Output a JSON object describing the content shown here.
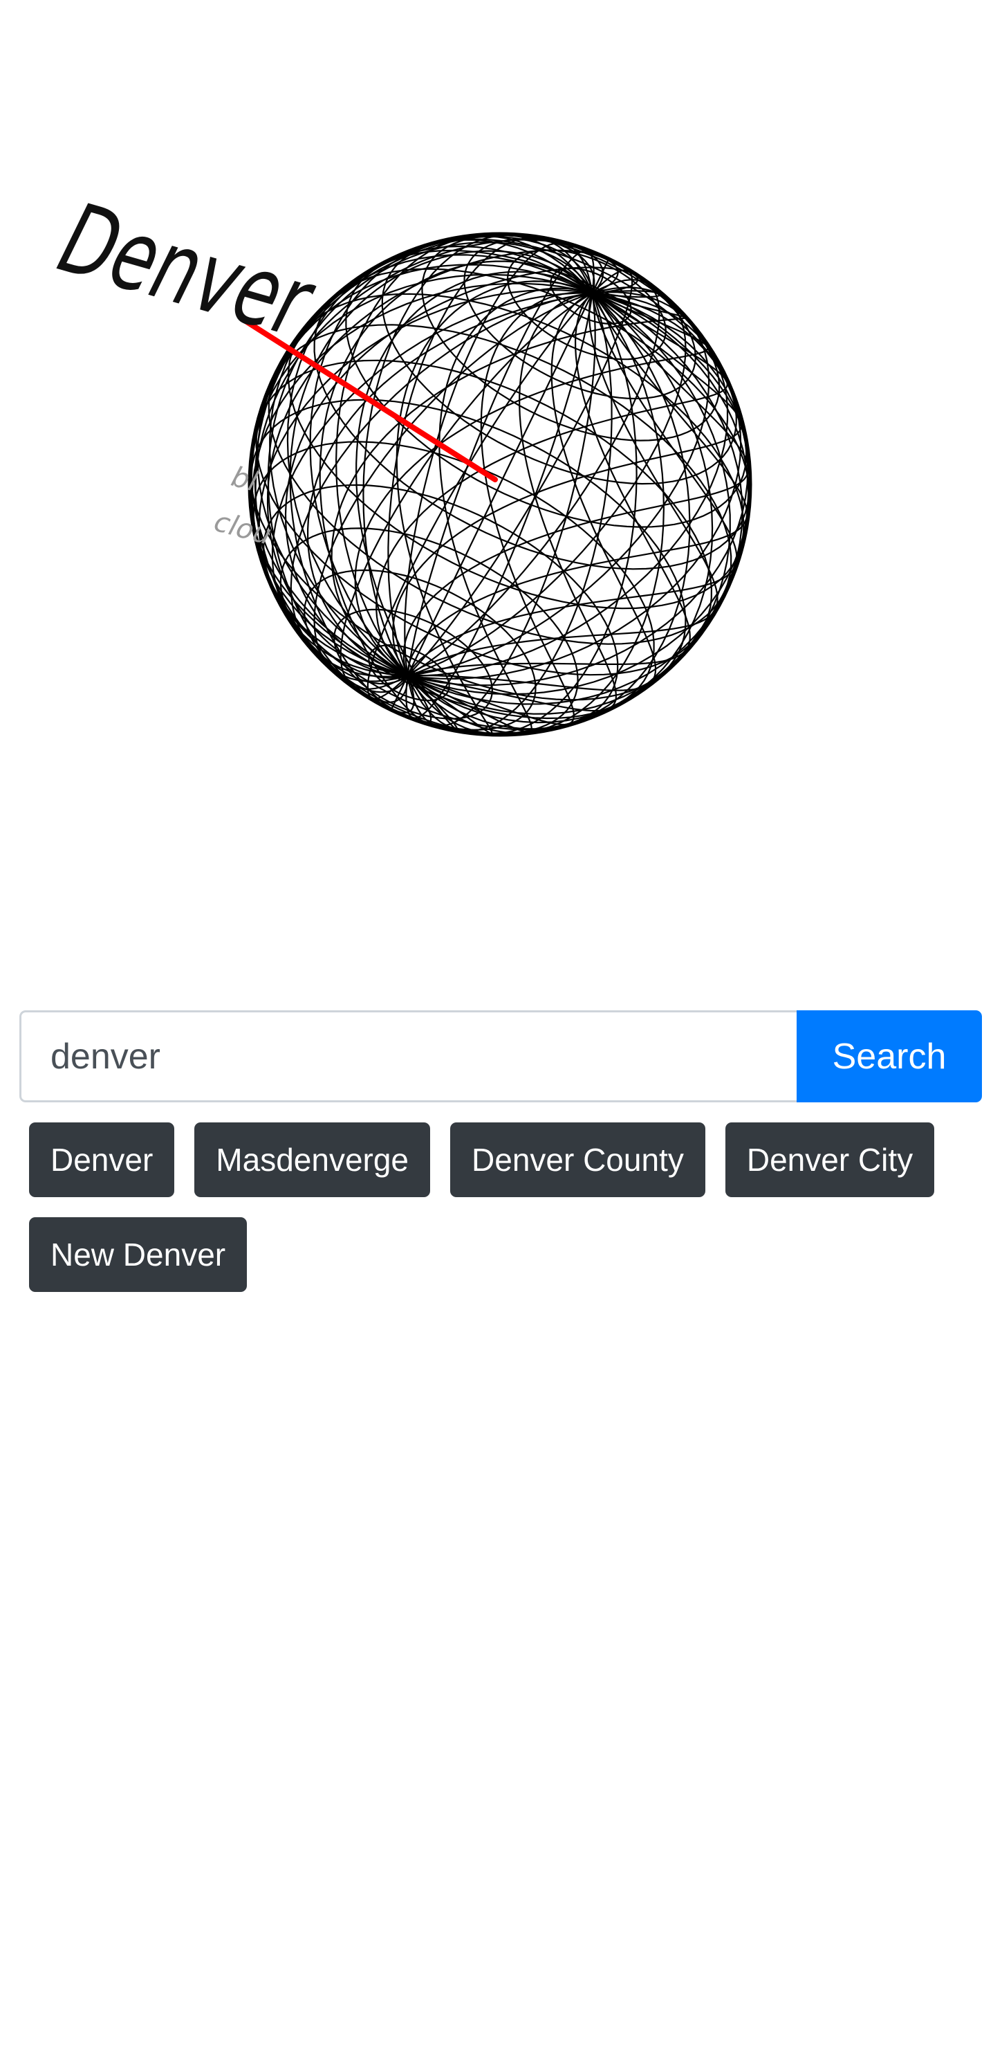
{
  "globe": {
    "label": "Denver",
    "faint_lines": [
      "bl",
      "clou"
    ],
    "wire_color": "#000000",
    "marker_color": "#ff0000"
  },
  "search": {
    "value": "denver",
    "button_label": "Search"
  },
  "suggestions": [
    "Denver",
    "Masdenverge",
    "Denver County",
    "Denver City",
    "New Denver"
  ],
  "colors": {
    "primary": "#007bff",
    "suggestion_bg": "#343a40",
    "suggestion_text": "#ffffff"
  }
}
